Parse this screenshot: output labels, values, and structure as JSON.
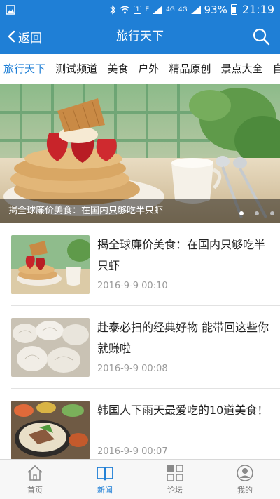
{
  "status_bar": {
    "network_label": "E",
    "sim_label": "1",
    "network_4g_a": "4G",
    "network_4g_b": "4G",
    "network_2g": "2G",
    "battery_percent": "93%",
    "time": "21:19"
  },
  "nav": {
    "back_label": "返回",
    "title": "旅行天下"
  },
  "tabs": [
    {
      "label": "旅行天下",
      "active": true
    },
    {
      "label": "测试频道",
      "active": false
    },
    {
      "label": "美食",
      "active": false
    },
    {
      "label": "户外",
      "active": false
    },
    {
      "label": "精品原创",
      "active": false
    },
    {
      "label": "景点大全",
      "active": false
    },
    {
      "label": "自然",
      "active": false
    }
  ],
  "banner": {
    "caption": "揭全球廉价美食：在国内只够吃半只虾",
    "page_count": 3,
    "active_page": 1
  },
  "news": [
    {
      "title": "揭全球廉价美食：在国内只够吃半只虾",
      "date": "2016-9-9 00:10"
    },
    {
      "title": "赴泰必扫的经典好物 能带回这些你就赚啦",
      "date": "2016-9-9 00:08"
    },
    {
      "title": "韩国人下雨天最爱吃的10道美食！",
      "date": "2016-9-9 00:07"
    }
  ],
  "bottom_tabs": [
    {
      "label": "首页",
      "icon": "home-icon",
      "active": false
    },
    {
      "label": "新闻",
      "icon": "news-icon",
      "active": true
    },
    {
      "label": "论坛",
      "icon": "forum-icon",
      "active": false
    },
    {
      "label": "我的",
      "icon": "profile-icon",
      "active": false
    }
  ],
  "colors": {
    "accent": "#1f7fd6",
    "inactive": "#7a7a7a",
    "date_gray": "#9a9a9a"
  }
}
